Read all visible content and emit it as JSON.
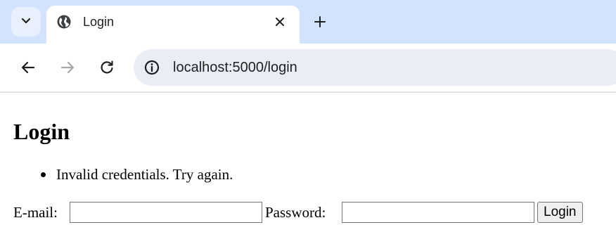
{
  "browser": {
    "tab": {
      "title": "Login"
    },
    "address_bar": {
      "url": "localhost:5000/login"
    }
  },
  "page": {
    "heading": "Login",
    "flash_messages": [
      "Invalid credentials. Try again."
    ],
    "form": {
      "email_label": "E-mail:",
      "email_value": "",
      "password_label": "Password:",
      "password_value": "",
      "submit_label": "Login"
    }
  },
  "colors": {
    "tabstrip_bg": "#d3e3fd",
    "omnibox_bg": "#e9eef6",
    "page_bg": "#ffffff"
  },
  "icons": {
    "tab_list": "chevron-down-icon",
    "favicon": "globe-icon",
    "tab_close": "close-icon",
    "new_tab": "plus-icon",
    "back": "arrow-left-icon",
    "forward": "arrow-right-icon",
    "reload": "reload-icon",
    "site_info": "info-icon"
  }
}
